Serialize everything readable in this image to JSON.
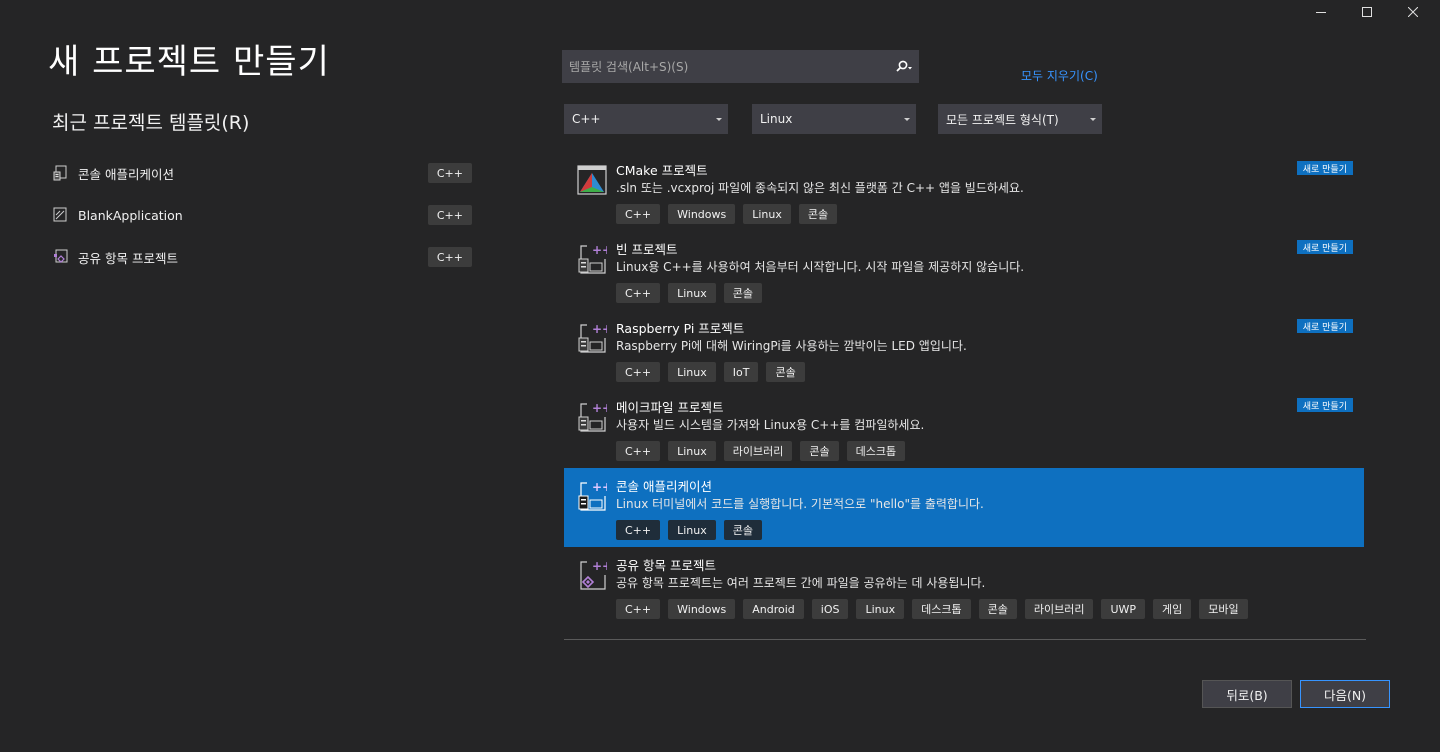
{
  "window_controls": {
    "minimize_icon": "minimize-icon",
    "maximize_icon": "maximize-icon",
    "close_icon": "close-icon"
  },
  "page_title": "새 프로젝트 만들기",
  "recent": {
    "title": "최근 프로젝트 템플릿(R)",
    "items": [
      {
        "label": "콘솔 애플리케이션",
        "tag": "C++",
        "icon": "console-app-icon"
      },
      {
        "label": "BlankApplication",
        "tag": "C++",
        "icon": "blank-app-icon"
      },
      {
        "label": "공유 항목 프로젝트",
        "tag": "C++",
        "icon": "shared-items-icon"
      }
    ]
  },
  "search": {
    "placeholder": "템플릿 검색(Alt+S)(S)",
    "value": ""
  },
  "clear_all": "모두 지우기(C)",
  "filters": {
    "language": "C++",
    "platform": "Linux",
    "project_type": "모든 프로젝트 형식(T)"
  },
  "new_badge": "새로 만들기",
  "templates": [
    {
      "name": "CMake 프로젝트",
      "desc": ".sln 또는 .vcxproj 파일에 종속되지 않은 최신 플랫폼 간 C++ 앱을 빌드하세요.",
      "tags": [
        "C++",
        "Windows",
        "Linux",
        "콘솔"
      ],
      "new": true,
      "selected": false,
      "icon": "cmake-icon"
    },
    {
      "name": "빈 프로젝트",
      "desc": "Linux용 C++를 사용하여 처음부터 시작합니다. 시작 파일을 제공하지 않습니다.",
      "tags": [
        "C++",
        "Linux",
        "콘솔"
      ],
      "new": true,
      "selected": false,
      "icon": "linux-cpp-project-icon"
    },
    {
      "name": "Raspberry Pi 프로젝트",
      "desc": "Raspberry Pi에 대해 WiringPi를 사용하는 깜박이는 LED 앱입니다.",
      "tags": [
        "C++",
        "Linux",
        "IoT",
        "콘솔"
      ],
      "new": true,
      "selected": false,
      "icon": "linux-cpp-project-icon"
    },
    {
      "name": "메이크파일 프로젝트",
      "desc": "사용자 빌드 시스템을 가져와 Linux용 C++를 컴파일하세요.",
      "tags": [
        "C++",
        "Linux",
        "라이브러리",
        "콘솔",
        "데스크톱"
      ],
      "new": true,
      "selected": false,
      "icon": "linux-cpp-project-icon"
    },
    {
      "name": "콘솔 애플리케이션",
      "desc": "Linux 터미널에서 코드를 실행합니다. 기본적으로 \"hello\"를 출력합니다.",
      "tags": [
        "C++",
        "Linux",
        "콘솔"
      ],
      "new": false,
      "selected": true,
      "icon": "linux-cpp-project-icon"
    },
    {
      "name": "공유 항목 프로젝트",
      "desc": "공유 항목 프로젝트는 여러 프로젝트 간에 파일을 공유하는 데 사용됩니다.",
      "tags": [
        "C++",
        "Windows",
        "Android",
        "iOS",
        "Linux",
        "데스크톱",
        "콘솔",
        "라이브러리",
        "UWP",
        "게임",
        "모바일"
      ],
      "new": false,
      "selected": false,
      "icon": "shared-items-icon"
    }
  ],
  "buttons": {
    "back": "뒤로(B)",
    "next": "다음(N)"
  },
  "colors": {
    "background": "#252526",
    "selected": "#0e70c0",
    "link": "#3794ff"
  }
}
